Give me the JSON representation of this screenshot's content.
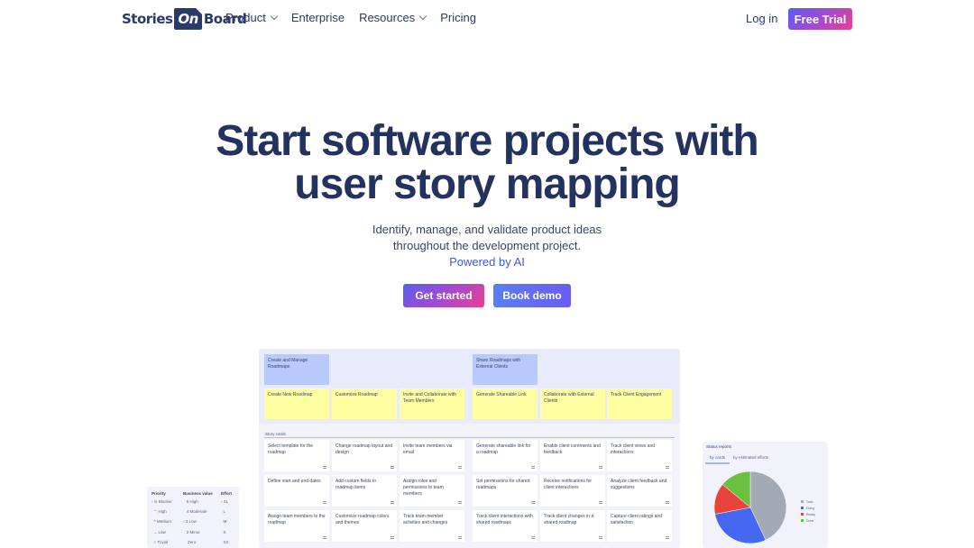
{
  "nav": {
    "logo": {
      "left": "Stories",
      "mid": "On",
      "right": "Board"
    },
    "links": [
      {
        "label": "Product",
        "has_dropdown": true
      },
      {
        "label": "Enterprise",
        "has_dropdown": false
      },
      {
        "label": "Resources",
        "has_dropdown": true
      },
      {
        "label": "Pricing",
        "has_dropdown": false
      }
    ],
    "login": "Log in",
    "trial": "Free Trial"
  },
  "hero": {
    "title_line1": "Start software projects with",
    "title_line2": "user story mapping",
    "subtitle_line1": "Identify, manage, and validate product ideas",
    "subtitle_line2": "throughout the development project.",
    "ai_link": "Powered by AI",
    "get_started": "Get started",
    "book_demo": "Book demo"
  },
  "story_map": {
    "epics": [
      "Create and Manage Roadmaps",
      "Share Roadmaps with External Clients"
    ],
    "features": [
      "Create New Roadmap",
      "Customize Roadmap",
      "Invite and Collaborate with Team Members",
      "Generate Shareable Link",
      "Collaborate with External Clients",
      "Track Client Engagement"
    ],
    "section_label": "Story cards",
    "cards": [
      [
        "Select template for the roadmap",
        "Change roadmap layout and design",
        "Invite team members via email",
        "Generate shareable link for a roadmap",
        "Enable client comments and feedback",
        "Track client views and interactions"
      ],
      [
        "Define start and end dates",
        "Add custom fields to roadmap items",
        "Assign roles and permissions to team members",
        "Set permissions for shared roadmaps",
        "Receive notifications for client interactions",
        "Analyze client feedback and suggestions"
      ],
      [
        "Assign team members to the roadmap",
        "Customize roadmap colors and themes",
        "Track team member activities and changes",
        "Track client interactions with shared roadmaps",
        "Track client changes in a shared roadmap",
        "Capture client ratings and satisfaction"
      ]
    ]
  },
  "priority_panel": {
    "headers": [
      "Priority",
      "Business value",
      "Effort"
    ],
    "priority": [
      "Blocker",
      "High",
      "Medium",
      "Low",
      "Trivial"
    ],
    "business_value": [
      "5 High",
      "4 Moderate",
      "3 Low",
      "2 Minor",
      "Zero"
    ],
    "effort": [
      "XL",
      "L",
      "M",
      "S",
      "XS"
    ]
  },
  "status_report": {
    "title": "Status reports",
    "tabs": [
      "by cards",
      "by estimated efforts"
    ],
    "active_tab": "by cards"
  },
  "chart_data": {
    "type": "pie",
    "title": "Status reports",
    "categories": [
      "Todo",
      "Doing",
      "Ready",
      "Done"
    ],
    "values": [
      43,
      29,
      14,
      14
    ],
    "colors": [
      "#a3a9b5",
      "#4468f0",
      "#e8443c",
      "#6cc040"
    ],
    "legend": "right"
  }
}
